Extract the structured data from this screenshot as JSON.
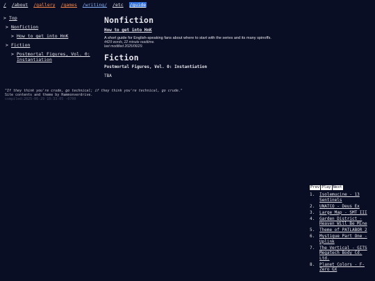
{
  "nav": {
    "items": [
      {
        "label": "/",
        "style": "white"
      },
      {
        "label": "/about",
        "style": "white"
      },
      {
        "label": "/gallery",
        "style": "orange"
      },
      {
        "label": "/games",
        "style": "orange"
      },
      {
        "label": "/writing/",
        "style": "blue"
      },
      {
        "label": "/etc",
        "style": "white"
      },
      {
        "label": "/guide",
        "style": "active"
      }
    ]
  },
  "toc": {
    "top": "Top",
    "nonfiction": "Nonfiction",
    "how_to": "How to get into HnK",
    "fiction": "Fiction",
    "postmortal": "Postmortal Figures, Vol. 0: Instantiation",
    "marker": ">"
  },
  "meta": {
    "quote": "\"If they think you're crude, go technical; if they think you're technical, go crude.\"",
    "credit": "Site contents and theme by Hammonverdrive.",
    "commit": "compiled:2025-06-29 10:33:05 -0700"
  },
  "main": {
    "nonfiction_heading": "Nonfiction",
    "article_title": "How to get into HnK",
    "article_desc": "A short guide for English-speaking fans about where to start with the series and its many spinoffs.",
    "article_words": "4429 words, 22 minute readtime.",
    "article_modified": "last modified 2025/06/29.",
    "fiction_heading": "Fiction",
    "fiction_title": "Postmortal Figures, Vol. 0: Instantiation",
    "fiction_status": "TBA"
  },
  "player": {
    "prev": "Prev",
    "play": "Play",
    "next": "Next",
    "tracks": [
      {
        "num": "1.",
        "title": "Isolemucine - 13 Sentinels"
      },
      {
        "num": "2.",
        "title": "UNATCO - Deus Ex"
      },
      {
        "num": "3.",
        "title": "Large Map - SMT III"
      },
      {
        "num": "4.",
        "title": "Garden District - Heaven Will Be Mine"
      },
      {
        "num": "5.",
        "title": "Theme of PATLABOR 2"
      },
      {
        "num": "6.",
        "title": "Mystique Part One - Uplink"
      },
      {
        "num": "7.",
        "title": "The Vertical - GITS Megatech Body Cd. Ltd."
      },
      {
        "num": "8.",
        "title": "Planet Colors - F-Zero GX"
      }
    ]
  },
  "colors": {
    "background": "#0a0e24",
    "text": "#e6e6ec",
    "nav_orange": "#ff8a4a",
    "nav_blue": "#8ab4ff",
    "nav_active_bg": "#2f6fe0"
  }
}
